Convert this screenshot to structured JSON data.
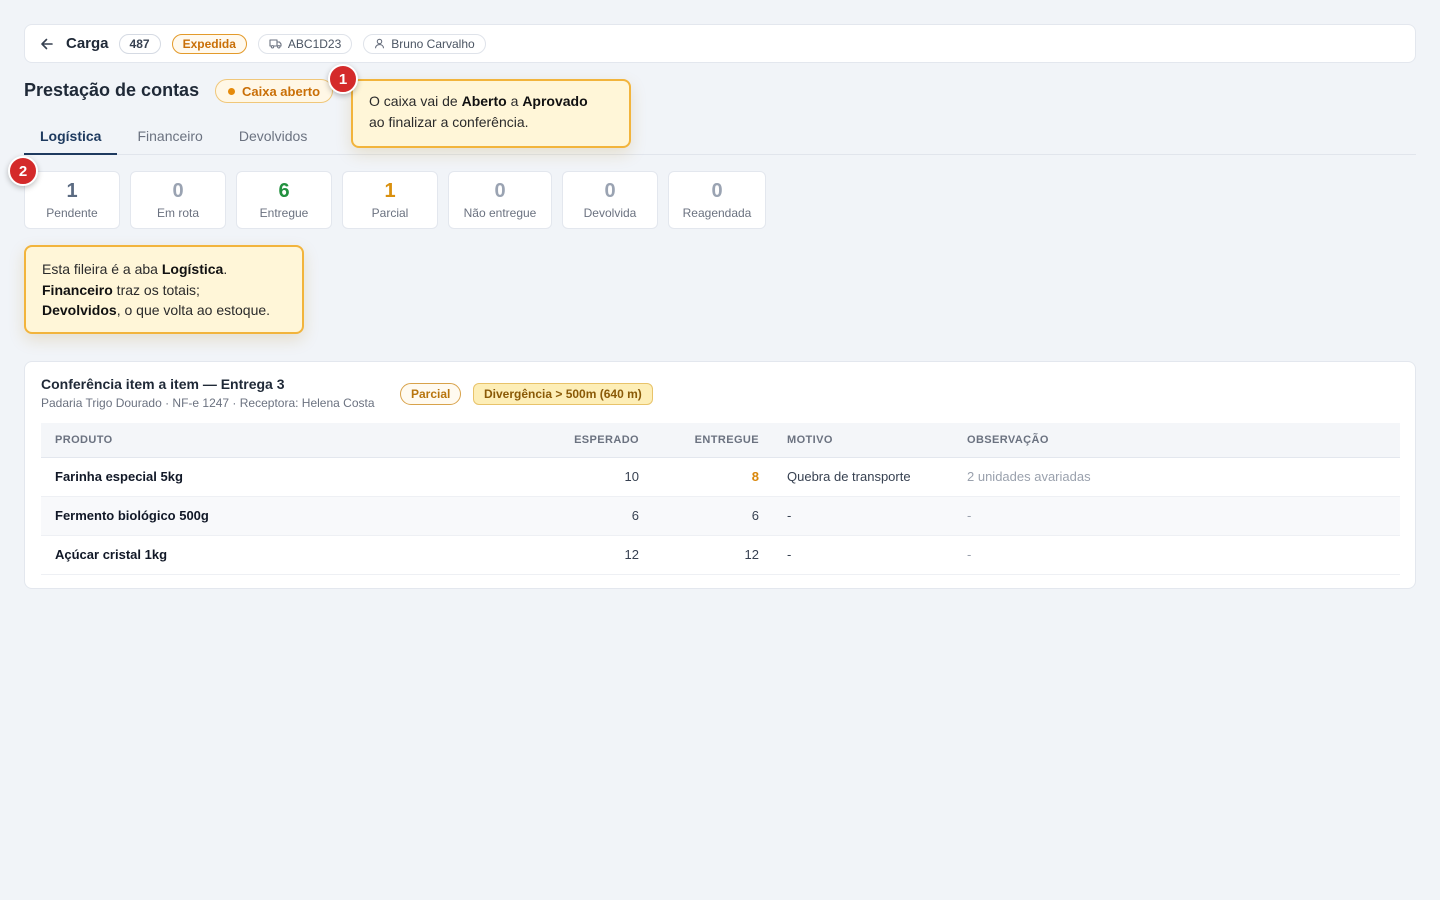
{
  "header": {
    "title": "Carga",
    "number": "487",
    "status": "Expedida",
    "plate": "ABC1D23",
    "driver": "Bruno Carvalho"
  },
  "page": {
    "title": "Prestação de contas",
    "caixa_status": "Caixa aberto"
  },
  "tabs": [
    {
      "label": "Logística",
      "active": true
    },
    {
      "label": "Financeiro",
      "active": false
    },
    {
      "label": "Devolvidos",
      "active": false
    }
  ],
  "stats": [
    {
      "value": "1",
      "label": "Pendente",
      "color": "#5b6b82"
    },
    {
      "value": "0",
      "label": "Em rota",
      "color": "#9aa3b2"
    },
    {
      "value": "6",
      "label": "Entregue",
      "color": "#22913f"
    },
    {
      "value": "1",
      "label": "Parcial",
      "color": "#d9900e"
    },
    {
      "value": "0",
      "label": "Não entregue",
      "color": "#9aa3b2"
    },
    {
      "value": "0",
      "label": "Devolvida",
      "color": "#9aa3b2"
    },
    {
      "value": "0",
      "label": "Reagendada",
      "color": "#9aa3b2"
    }
  ],
  "callouts": {
    "one": {
      "badge": "1",
      "t1": "O caixa vai de ",
      "b1": "Aberto",
      "t2": " a ",
      "b2": "Aprovado",
      "t3": "ao finalizar a conferência."
    },
    "two": {
      "badge": "2",
      "t1": "Esta fileira é a aba ",
      "b1": "Logística",
      "t2": ".",
      "b2": "Financeiro",
      "t3": " traz os totais;",
      "b3": "Devolvidos",
      "t4": ", o que volta ao estoque."
    }
  },
  "conference": {
    "title": "Conferência item a item — Entrega 3",
    "subtitle": "Padaria Trigo Dourado · NF-e 1247 · Receptora: Helena Costa",
    "tag_status": "Parcial",
    "tag_divergence": "Divergência > 500m (640 m)",
    "columns": {
      "produto": "PRODUTO",
      "esperado": "ESPERADO",
      "entregue": "ENTREGUE",
      "motivo": "MOTIVO",
      "observacao": "OBSERVAÇÃO"
    },
    "rows": [
      {
        "produto": "Farinha especial 5kg",
        "esperado": "10",
        "entregue": "8",
        "motivo": "Quebra de transporte",
        "observacao": "2 unidades avariadas"
      },
      {
        "produto": "Fermento biológico 500g",
        "esperado": "6",
        "entregue": "6",
        "motivo": "-",
        "observacao": "-"
      },
      {
        "produto": "Açúcar cristal 1kg",
        "esperado": "12",
        "entregue": "12",
        "motivo": "-",
        "observacao": "-"
      }
    ]
  }
}
